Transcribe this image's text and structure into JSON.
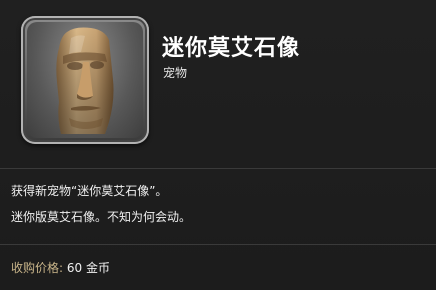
{
  "item": {
    "name": "迷你莫艾石像",
    "category": "宠物",
    "icon": "moai-statue-icon"
  },
  "description": {
    "line1": "获得新宠物“迷你莫艾石像”。",
    "line2": "迷你版莫艾石像。不知为何会动。"
  },
  "price": {
    "label": "收购价格:",
    "value": "60 金币"
  },
  "colors": {
    "background": "#1e1e1e",
    "price_label": "#c9b58a",
    "text": "#f0f0f0"
  }
}
